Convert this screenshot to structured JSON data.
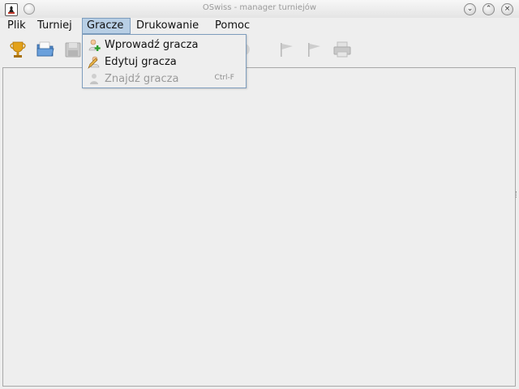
{
  "window": {
    "title": "OSwiss - manager turniejów",
    "controls": [
      "minimize-icon",
      "maximize-icon",
      "close-icon"
    ]
  },
  "menubar": {
    "items": [
      {
        "label": "Plik"
      },
      {
        "label": "Turniej"
      },
      {
        "label": "Gracze",
        "active": true
      },
      {
        "label": "Drukowanie"
      },
      {
        "label": "Pomoc"
      }
    ]
  },
  "toolbar": {
    "buttons": [
      {
        "icon": "trophy-icon",
        "enabled": true
      },
      {
        "icon": "open-folder-icon",
        "enabled": true
      },
      {
        "icon": "save-icon",
        "enabled": false
      },
      {
        "icon": "round-icon",
        "enabled": false
      },
      {
        "icon": "flag-icon",
        "enabled": false
      },
      {
        "icon": "flag-icon",
        "enabled": false
      },
      {
        "icon": "printer-icon",
        "enabled": false
      }
    ]
  },
  "dropdown": {
    "items": [
      {
        "label": "Wprowadź gracza",
        "icon": "add-user-icon",
        "enabled": true,
        "accelerator": ""
      },
      {
        "label": "Edytuj gracza",
        "icon": "edit-user-icon",
        "enabled": true,
        "accelerator": ""
      },
      {
        "label": "Znajdź gracza",
        "icon": "find-user-icon",
        "enabled": false,
        "accelerator": "Ctrl-F"
      }
    ]
  },
  "colors": {
    "menu_highlight": "#b8cfe5",
    "menu_border": "#7e9dbd",
    "background": "#eeeeee",
    "disabled_text": "#9a9a9a"
  }
}
